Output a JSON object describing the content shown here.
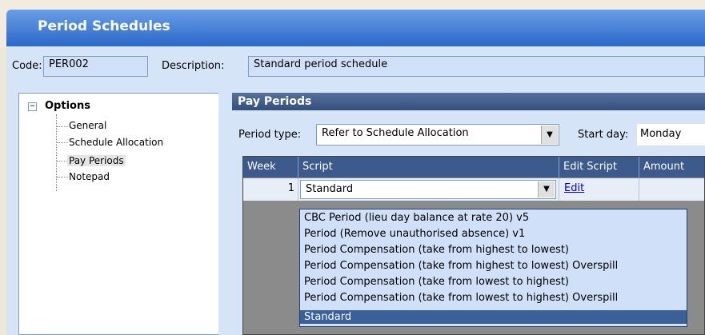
{
  "window": {
    "title": "Period Schedules"
  },
  "header": {
    "code_label": "Code:",
    "code_value": "PER002",
    "description_label": "Description:",
    "description_value": "Standard period schedule"
  },
  "tree": {
    "root_label": "Options",
    "toggle": "−",
    "items": [
      "General",
      "Schedule Allocation",
      "Pay Periods",
      "Notepad"
    ],
    "selected": "Pay Periods"
  },
  "panel": {
    "title": "Pay Periods",
    "period_type_label": "Period type:",
    "period_type_value": "Refer to Schedule Allocation",
    "start_day_label": "Start day:",
    "start_day_value": "Monday"
  },
  "grid": {
    "columns": [
      "Week",
      "Script",
      "Edit Script",
      "Amount"
    ],
    "rows": [
      {
        "week": "1",
        "script": "Standard",
        "edit": "Edit",
        "amount": ""
      }
    ]
  },
  "dropdown": {
    "options": [
      "CBC Period (lieu day balance at rate 20) v5",
      "Period (Remove unauthorised absence) v1",
      "Period Compensation (take from highest to lowest)",
      "Period Compensation (take from highest to lowest) Overspill",
      "Period Compensation (take from lowest to highest)",
      "Period Compensation (take from lowest to highest) Overspill",
      "Standard"
    ],
    "selected": "Standard"
  },
  "icons": {
    "combo_arrow": "▼"
  },
  "colors": {
    "title_gradient_top": "#6a9ee6",
    "title_gradient_bottom": "#2a68c8",
    "panel_header": "#3c5a8c",
    "selected_option": "#3a5f99"
  }
}
